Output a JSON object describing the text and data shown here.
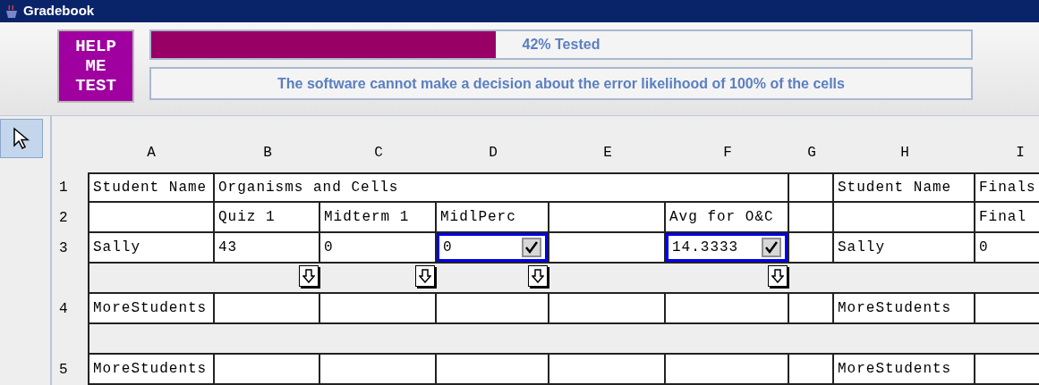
{
  "window": {
    "title": "Gradebook"
  },
  "help_button": {
    "lines": [
      "HELP",
      "ME",
      "TEST"
    ]
  },
  "progress": {
    "label": "42% Tested",
    "level": 0.42
  },
  "message": "The software cannot make a decision about the error likelihood of 100% of the cells",
  "tools": [
    {
      "kind": "pointer",
      "selected": true
    }
  ],
  "columns": [
    "A",
    "B",
    "C",
    "D",
    "E",
    "F",
    "G",
    "H",
    "I"
  ],
  "rows": [
    {
      "kind": "cells",
      "number": "1",
      "cells": [
        {
          "text": "Student Name"
        },
        {
          "text": "Organisms and Cells"
        },
        {
          "merged": true
        },
        {
          "merged": true
        },
        {
          "merged": true
        },
        {
          "merged": true
        },
        {},
        {
          "text": "Student Name"
        },
        {
          "text": "Finals"
        }
      ]
    },
    {
      "kind": "cells",
      "number": "2",
      "cells": [
        {},
        {
          "text": "Quiz 1"
        },
        {
          "text": "Midterm 1"
        },
        {
          "text": "MidlPerc"
        },
        {},
        {
          "text": "Avg for O&C"
        },
        {},
        {},
        {
          "text": "Final"
        }
      ]
    },
    {
      "kind": "cells",
      "number": "3",
      "cells": [
        {
          "text": "Sally"
        },
        {
          "text": "43"
        },
        {
          "text": "0"
        },
        {
          "text": "0",
          "kind": "checked",
          "checked": true
        },
        {},
        {
          "text": "14.3333",
          "kind": "checked",
          "checked": true
        },
        {},
        {
          "text": "Sally"
        },
        {
          "text": "0"
        }
      ]
    },
    {
      "kind": "gap",
      "arrows": [
        false,
        true,
        true,
        true,
        false,
        true,
        false,
        false,
        false
      ]
    },
    {
      "kind": "cells",
      "number": "4",
      "cells": [
        {
          "text": "MoreStudents"
        },
        {},
        {},
        {},
        {},
        {},
        {},
        {
          "text": "MoreStudents"
        },
        {}
      ]
    },
    {
      "kind": "gap"
    },
    {
      "kind": "cells",
      "number": "5",
      "cells": [
        {
          "text": "MoreStudents"
        },
        {},
        {},
        {},
        {},
        {},
        {},
        {
          "text": "MoreStudents"
        },
        {}
      ]
    }
  ]
}
